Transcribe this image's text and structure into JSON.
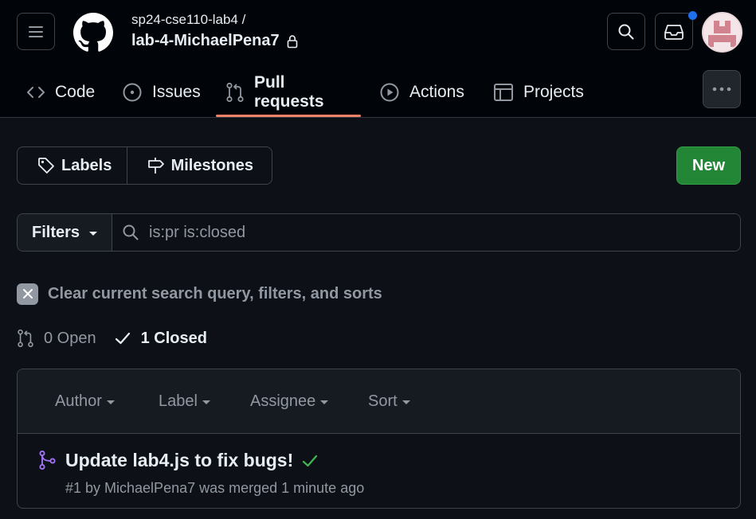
{
  "header": {
    "owner": "sp24-cse110-lab4 /",
    "repo": "lab-4-MichaelPena7",
    "repo_visibility_icon": "lock-icon",
    "notification_dot_color": "#1f6feb"
  },
  "tabs": [
    {
      "label": "Code",
      "icon": "code-icon"
    },
    {
      "label": "Issues",
      "icon": "issue-opened-icon"
    },
    {
      "label": "Pull requests",
      "icon": "git-pull-request-icon",
      "selected": true
    },
    {
      "label": "Actions",
      "icon": "play-icon"
    },
    {
      "label": "Projects",
      "icon": "table-icon"
    }
  ],
  "toolbar": {
    "labels": "Labels",
    "milestones": "Milestones",
    "new": "New"
  },
  "filters": {
    "button": "Filters",
    "query": "is:pr is:closed"
  },
  "clear_query": "Clear current search query, filters, and sorts",
  "states": {
    "open": "0 Open",
    "closed": "1 Closed"
  },
  "list_header": [
    "Author",
    "Label",
    "Assignee",
    "Sort"
  ],
  "pull_requests": [
    {
      "title": "Update lab4.js to fix bugs!",
      "status_icon": "check-icon",
      "meta": "#1 by MichaelPena7 was merged 1 minute ago"
    }
  ],
  "colors": {
    "accent_underline": "#f78166",
    "new_button": "#238636",
    "merged": "#a371f7",
    "success": "#3fb950"
  }
}
